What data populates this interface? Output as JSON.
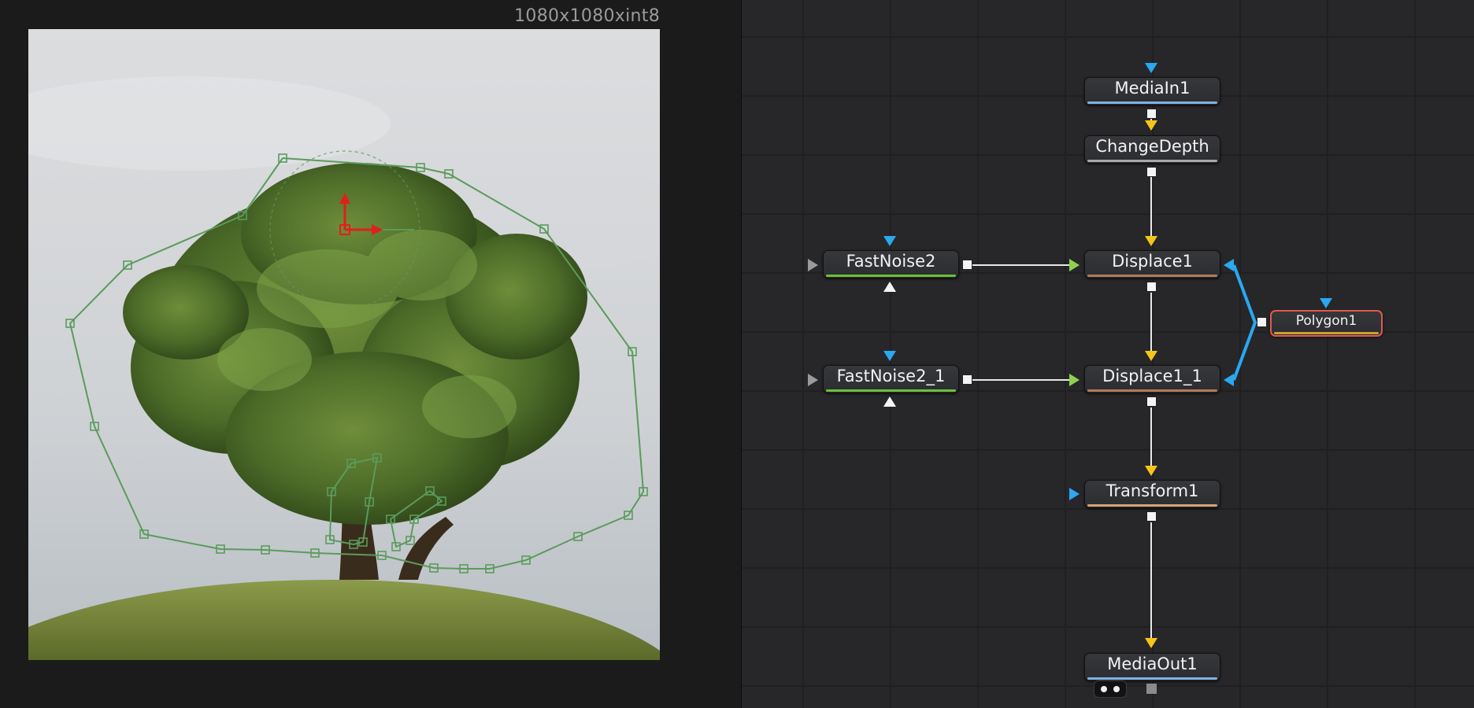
{
  "viewer": {
    "resolution_label": "1080x1080xint8",
    "image_subject": "tree on grassy hill with polygon mask"
  },
  "nodes": [
    {
      "id": "mediain1",
      "label": "MediaIn1",
      "stripe": "#7fb0e6"
    },
    {
      "id": "changedepth",
      "label": "ChangeDepth",
      "stripe": "#a8a8a8"
    },
    {
      "id": "displace1",
      "label": "Displace1",
      "stripe": "#b07b5a"
    },
    {
      "id": "displace1_1",
      "label": "Displace1_1",
      "stripe": "#b07b5a"
    },
    {
      "id": "transform1",
      "label": "Transform1",
      "stripe": "#d4a374"
    },
    {
      "id": "mediaout1",
      "label": "MediaOut1",
      "stripe": "#7fb0e6"
    },
    {
      "id": "fastnoise2",
      "label": "FastNoise2",
      "stripe": "#6bbf3c"
    },
    {
      "id": "fastnoise2_1",
      "label": "FastNoise2_1",
      "stripe": "#6bbf3c"
    },
    {
      "id": "polygon1",
      "label": "Polygon1",
      "stripe": "#c9a032"
    }
  ],
  "colors": {
    "flow_background": "#27272a",
    "wire": "#e8e8e8",
    "mask_wire": "#2aa8f0",
    "input_yellow": "#f5c518",
    "input_blue": "#2aa8f0",
    "input_green": "#8fd14f",
    "selected_outline": "#e25a49",
    "mask_polygon": "#5b9b5c"
  },
  "icons": {
    "viewer_toggle": "viewer-dots-icon",
    "gray_square": "square-icon"
  }
}
